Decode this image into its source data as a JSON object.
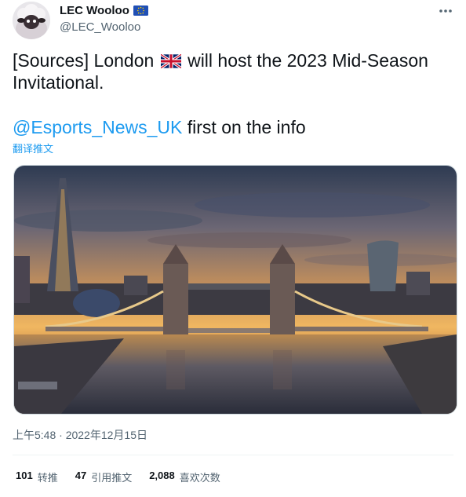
{
  "author": {
    "display_name": "LEC Wooloo",
    "handle": "@LEC_Wooloo",
    "badge_icon": "eu-flag-icon"
  },
  "tweet": {
    "text_part1": "[Sources] London ",
    "flag": "uk-flag-icon",
    "text_part2": " will host the 2023 Mid-Season Invitational.",
    "mention": "@Esports_News_UK",
    "text_part3": " first on the info",
    "translate_label": "翻译推文",
    "timestamp": "上午5:48 · 2022年12月15日"
  },
  "stats": [
    {
      "count": "101",
      "label": "转推"
    },
    {
      "count": "47",
      "label": "引用推文"
    },
    {
      "count": "2,088",
      "label": "喜欢次数"
    }
  ],
  "colors": {
    "link": "#1d9bf0",
    "secondary_text": "#536471",
    "primary_text": "#0f1419"
  }
}
